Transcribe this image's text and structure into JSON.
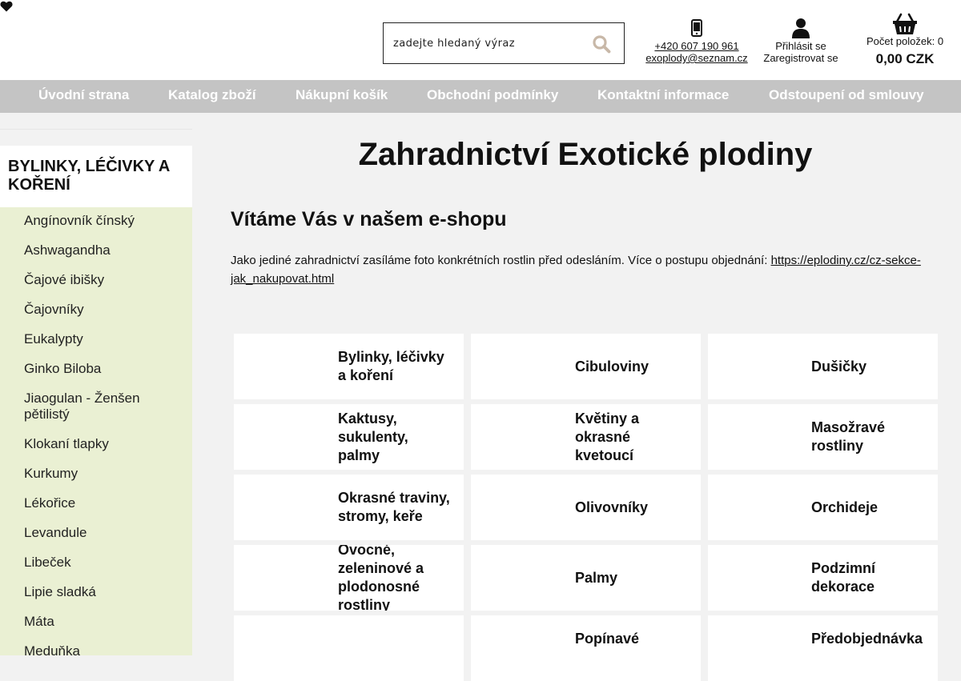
{
  "header": {
    "search_placeholder": "zadejte hledaný výraz",
    "phone": "+420 607 190 961",
    "email": "exoplody@seznam.cz",
    "login": "Přihlásit se",
    "register": "Zaregistrovat se",
    "cart_count_label": "Počet položek: 0",
    "cart_total": "0,00 CZK"
  },
  "nav": {
    "items": [
      "Úvodní strana",
      "Katalog zboží",
      "Nákupní košík",
      "Obchodní podmínky",
      "Kontaktní informace",
      "Odstoupení od smlouvy"
    ]
  },
  "sidebar": {
    "category": "Bylinky, léčivky a koření",
    "subcategories": [
      "Angínovník čínský",
      "Ashwagandha",
      "Čajové ibišky",
      "Čajovníky",
      "Eukalypty",
      "Ginko Biloba",
      "Jiaogulan - Ženšen pětilistý",
      "Klokaní tlapky",
      "Kurkumy",
      "Lékořice",
      "Levandule",
      "Libeček",
      "Lipie sladká",
      "Máta",
      "Meduňka"
    ]
  },
  "main": {
    "title": "Zahradnictví Exotické plodiny",
    "subtitle": "Vítáme Vás v našem e-shopu",
    "intro_text": "Jako jediné zahradnictví zasíláme foto konkrétních rostlin před odesláním. Více o postupu objednání: ",
    "intro_link": "https://eplodiny.cz/cz-sekce-jak_nakupovat.html",
    "categories": [
      "Bylinky, léčivky a koření",
      "Cibuloviny",
      "Dušičky",
      "Kaktusy, sukulenty, palmy",
      "Květiny a okrasné kvetoucí",
      "Masožravé rostliny",
      "Okrasné traviny, stromy, keře",
      "Olivovníky",
      "Orchideje",
      "Ovocné, zeleninové a plodonosné rostliny",
      "Palmy",
      "Podzimní dekorace",
      "Popínavé",
      "Předobjednávka"
    ]
  }
}
